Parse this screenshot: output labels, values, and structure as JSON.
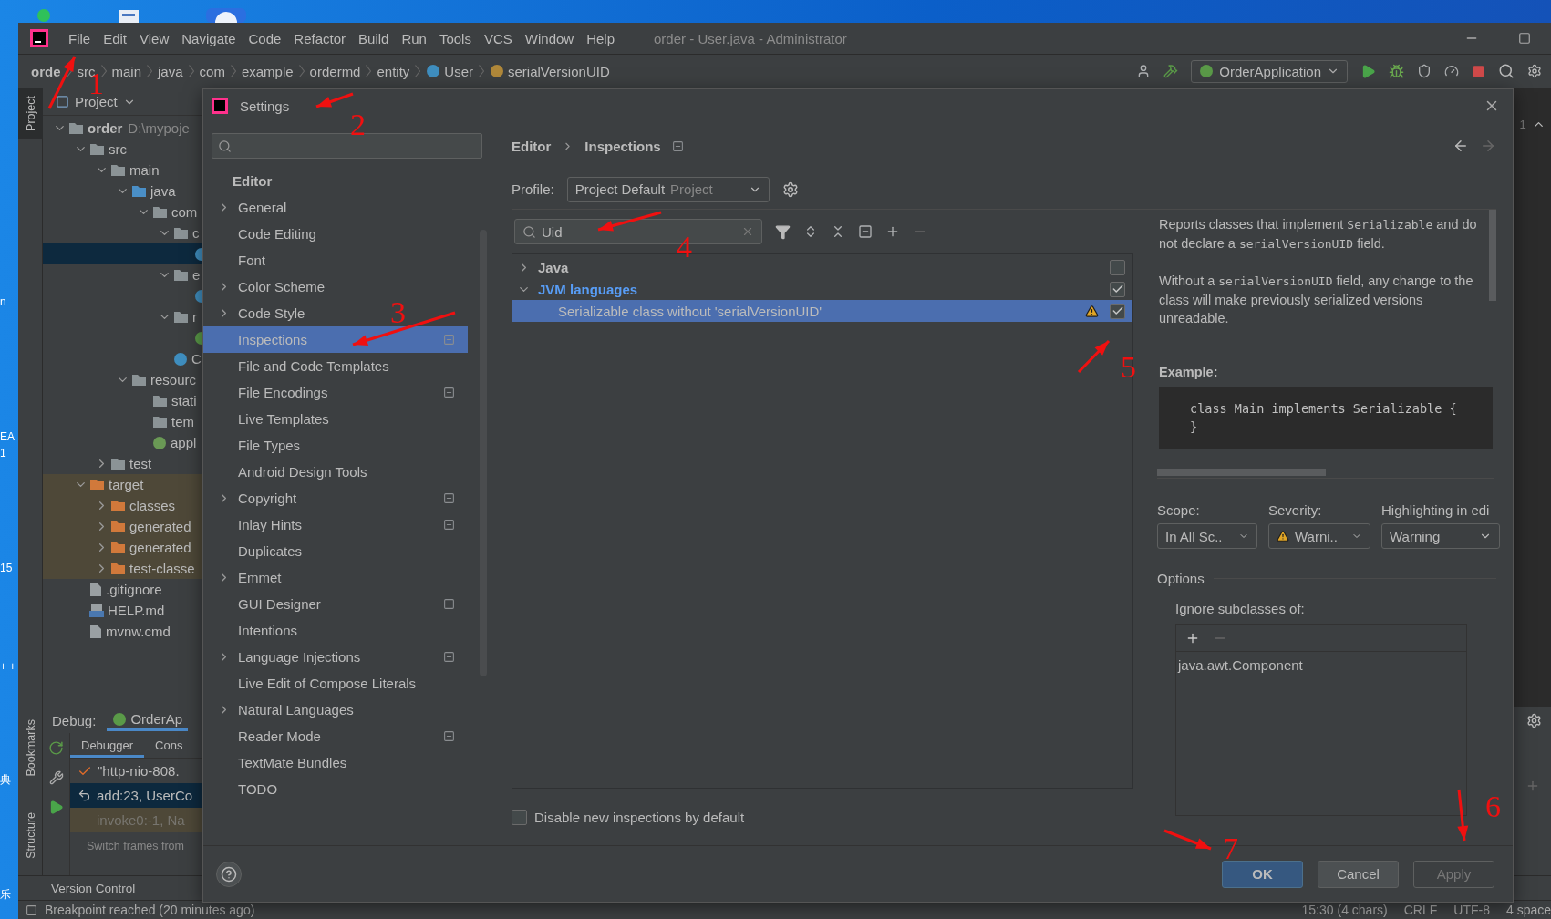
{
  "desktop": {
    "labels": [
      "n",
      "EA",
      "1",
      "15",
      "+ +",
      "典",
      "乐"
    ]
  },
  "window": {
    "title": "order - User.java - Administrator"
  },
  "menu": [
    "File",
    "Edit",
    "View",
    "Navigate",
    "Code",
    "Refactor",
    "Build",
    "Run",
    "Tools",
    "VCS",
    "Window",
    "Help"
  ],
  "breadcrumbs": [
    {
      "label": "orde",
      "kind": "module"
    },
    {
      "label": "src",
      "kind": "folder"
    },
    {
      "label": "main",
      "kind": "folder"
    },
    {
      "label": "java",
      "kind": "folder"
    },
    {
      "label": "com",
      "kind": "folder"
    },
    {
      "label": "example",
      "kind": "folder"
    },
    {
      "label": "ordermd",
      "kind": "folder"
    },
    {
      "label": "entity",
      "kind": "folder"
    },
    {
      "label": "User",
      "kind": "class"
    },
    {
      "label": "serialVersionUID",
      "kind": "field"
    }
  ],
  "run_config": "OrderApplication",
  "tool_strip": {
    "top": [
      {
        "label": "Project",
        "selected": true
      }
    ],
    "bottom": [
      {
        "label": "Bookmarks",
        "selected": false
      },
      {
        "label": "Structure",
        "selected": false
      }
    ]
  },
  "project": {
    "title": "Project",
    "tree": [
      {
        "label": "order",
        "path": "D:\\mypoje",
        "kind": "module",
        "expanded": true,
        "selected": false,
        "children": [
          {
            "label": "src",
            "kind": "folder",
            "expanded": true,
            "selected": false,
            "children": [
              {
                "label": "main",
                "kind": "folder",
                "expanded": true,
                "selected": false,
                "children": [
                  {
                    "label": "java",
                    "kind": "source-folder",
                    "expanded": true,
                    "selected": false,
                    "children": [
                      {
                        "label": "com",
                        "kind": "package",
                        "expanded": true,
                        "selected": false,
                        "children": [
                          {
                            "label": "c",
                            "kind": "package",
                            "expanded": true,
                            "selected": false,
                            "children": [
                              {
                                "kind": "class",
                                "selected": true
                              }
                            ]
                          },
                          {
                            "label": "e",
                            "kind": "package",
                            "expanded": true,
                            "selected": false,
                            "children": [
                              {
                                "kind": "class",
                                "selected": false
                              }
                            ]
                          },
                          {
                            "label": "r",
                            "kind": "package",
                            "expanded": true,
                            "selected": false,
                            "children": [
                              {
                                "kind": "spring-class",
                                "selected": false
                              }
                            ]
                          },
                          {
                            "label": "C",
                            "kind": "app-class",
                            "selected": false
                          }
                        ]
                      }
                    ]
                  },
                  {
                    "label": "resourc",
                    "kind": "resource-folder",
                    "expanded": true,
                    "selected": false,
                    "children": [
                      {
                        "label": "stati",
                        "kind": "folder",
                        "selected": false
                      },
                      {
                        "label": "tem",
                        "kind": "folder",
                        "selected": false
                      },
                      {
                        "label": "appl",
                        "kind": "config",
                        "selected": false
                      }
                    ]
                  }
                ]
              },
              {
                "label": "test",
                "kind": "folder",
                "expanded": false,
                "selected": false
              }
            ]
          },
          {
            "label": "target",
            "kind": "excluded-folder",
            "expanded": true,
            "selected": false,
            "children": [
              {
                "label": "classes",
                "kind": "excluded-folder",
                "expanded": false,
                "selected": false
              },
              {
                "label": "generated",
                "kind": "excluded-folder",
                "expanded": false,
                "selected": false
              },
              {
                "label": "generated",
                "kind": "excluded-folder",
                "expanded": false,
                "selected": false
              },
              {
                "label": "test-classe",
                "kind": "excluded-folder",
                "expanded": false,
                "selected": false
              }
            ]
          },
          {
            "label": ".gitignore",
            "kind": "file",
            "selected": false
          },
          {
            "label": "HELP.md",
            "kind": "markdown",
            "selected": false
          },
          {
            "label": "mvnw.cmd",
            "kind": "file",
            "selected": false
          }
        ]
      }
    ]
  },
  "debug": {
    "title": "Debug:",
    "session": "OrderAp",
    "tabs": [
      {
        "label": "Debugger",
        "selected": true
      },
      {
        "label": "Cons",
        "selected": false
      }
    ],
    "frames": [
      {
        "label": "\"http-nio-808.",
        "kind": "thread",
        "selected": false,
        "disabled": false
      },
      {
        "label": "add:23, UserCo",
        "kind": "frame",
        "selected": true,
        "disabled": false
      },
      {
        "label": "invoke0:-1, Na",
        "kind": "frame",
        "selected": false,
        "disabled": true
      }
    ],
    "hint": "Switch frames from"
  },
  "bottom_tabs": [
    "Version Control"
  ],
  "status_bar": {
    "message": "Breakpoint reached (20 minutes ago)",
    "items": [
      "15:30 (4 chars)",
      "CRLF",
      "UTF-8",
      "4 space"
    ]
  },
  "right_edge": {
    "text": "1"
  },
  "settings": {
    "title": "Settings",
    "nav": {
      "section": "Editor",
      "items": [
        {
          "label": "General",
          "expandable": true,
          "project_level": false,
          "selected": false
        },
        {
          "label": "Code Editing",
          "expandable": false,
          "project_level": false,
          "selected": false
        },
        {
          "label": "Font",
          "expandable": false,
          "project_level": false,
          "selected": false
        },
        {
          "label": "Color Scheme",
          "expandable": true,
          "project_level": false,
          "selected": false
        },
        {
          "label": "Code Style",
          "expandable": true,
          "project_level": false,
          "selected": false
        },
        {
          "label": "Inspections",
          "expandable": false,
          "project_level": true,
          "selected": true
        },
        {
          "label": "File and Code Templates",
          "expandable": false,
          "project_level": false,
          "selected": false
        },
        {
          "label": "File Encodings",
          "expandable": false,
          "project_level": true,
          "selected": false
        },
        {
          "label": "Live Templates",
          "expandable": false,
          "project_level": false,
          "selected": false
        },
        {
          "label": "File Types",
          "expandable": false,
          "project_level": false,
          "selected": false
        },
        {
          "label": "Android Design Tools",
          "expandable": false,
          "project_level": false,
          "selected": false
        },
        {
          "label": "Copyright",
          "expandable": true,
          "project_level": true,
          "selected": false
        },
        {
          "label": "Inlay Hints",
          "expandable": false,
          "project_level": true,
          "selected": false
        },
        {
          "label": "Duplicates",
          "expandable": false,
          "project_level": false,
          "selected": false
        },
        {
          "label": "Emmet",
          "expandable": true,
          "project_level": false,
          "selected": false
        },
        {
          "label": "GUI Designer",
          "expandable": false,
          "project_level": true,
          "selected": false
        },
        {
          "label": "Intentions",
          "expandable": false,
          "project_level": false,
          "selected": false
        },
        {
          "label": "Language Injections",
          "expandable": true,
          "project_level": true,
          "selected": false
        },
        {
          "label": "Live Edit of Compose Literals",
          "expandable": false,
          "project_level": false,
          "selected": false
        },
        {
          "label": "Natural Languages",
          "expandable": true,
          "project_level": false,
          "selected": false
        },
        {
          "label": "Reader Mode",
          "expandable": false,
          "project_level": true,
          "selected": false
        },
        {
          "label": "TextMate Bundles",
          "expandable": false,
          "project_level": false,
          "selected": false
        },
        {
          "label": "TODO",
          "expandable": false,
          "project_level": false,
          "selected": false
        }
      ]
    },
    "breadcrumb": [
      "Editor",
      "Inspections"
    ],
    "profile": {
      "label": "Profile:",
      "value": "Project Default",
      "scope": "Project"
    },
    "filter": {
      "value": "Uid"
    },
    "inspections": [
      {
        "label": "Java",
        "kind": "group",
        "expanded": false,
        "checked": false,
        "highlighted": false,
        "selected": false
      },
      {
        "label": "JVM languages",
        "kind": "group",
        "expanded": true,
        "checked": true,
        "highlighted": true,
        "selected": false,
        "children": [
          {
            "label": "Serializable class without 'serialVersionUID'",
            "kind": "inspection",
            "checked": true,
            "highlighted": false,
            "selected": true
          }
        ]
      }
    ],
    "description": {
      "paragraphs": [
        [
          {
            "kind": "text",
            "text": "Reports classes that implement "
          },
          {
            "kind": "code",
            "text": "Serializable"
          },
          {
            "kind": "text",
            "text": " and do not declare a "
          },
          {
            "kind": "code",
            "text": "serialVersionUID"
          },
          {
            "kind": "text",
            "text": " field."
          }
        ],
        [
          {
            "kind": "text",
            "text": "Without a "
          },
          {
            "kind": "code",
            "text": "serialVersionUID"
          },
          {
            "kind": "text",
            "text": " field, any change to the class will make previously serialized versions unreadable."
          }
        ]
      ],
      "example_label": "Example:",
      "example_code": [
        "class Main implements Serializable {",
        "}"
      ]
    },
    "scope": {
      "label": "Scope:",
      "value": "In All Sc.."
    },
    "severity": {
      "label": "Severity:",
      "value": "Warni.."
    },
    "highlighting": {
      "label": "Highlighting in edi",
      "value": "Warning"
    },
    "options": {
      "title": "Options",
      "list_label": "Ignore subclasses of:",
      "items": [
        "java.awt.Component"
      ]
    },
    "disable_new": {
      "label": "Disable new inspections by default",
      "checked": false
    },
    "buttons": [
      {
        "label": "OK",
        "kind": "primary",
        "disabled": false
      },
      {
        "label": "Cancel",
        "kind": "normal",
        "disabled": false
      },
      {
        "label": "Apply",
        "kind": "normal",
        "disabled": true
      }
    ]
  },
  "annotations": [
    "1",
    "2",
    "3",
    "4",
    "5",
    "6",
    "7"
  ]
}
